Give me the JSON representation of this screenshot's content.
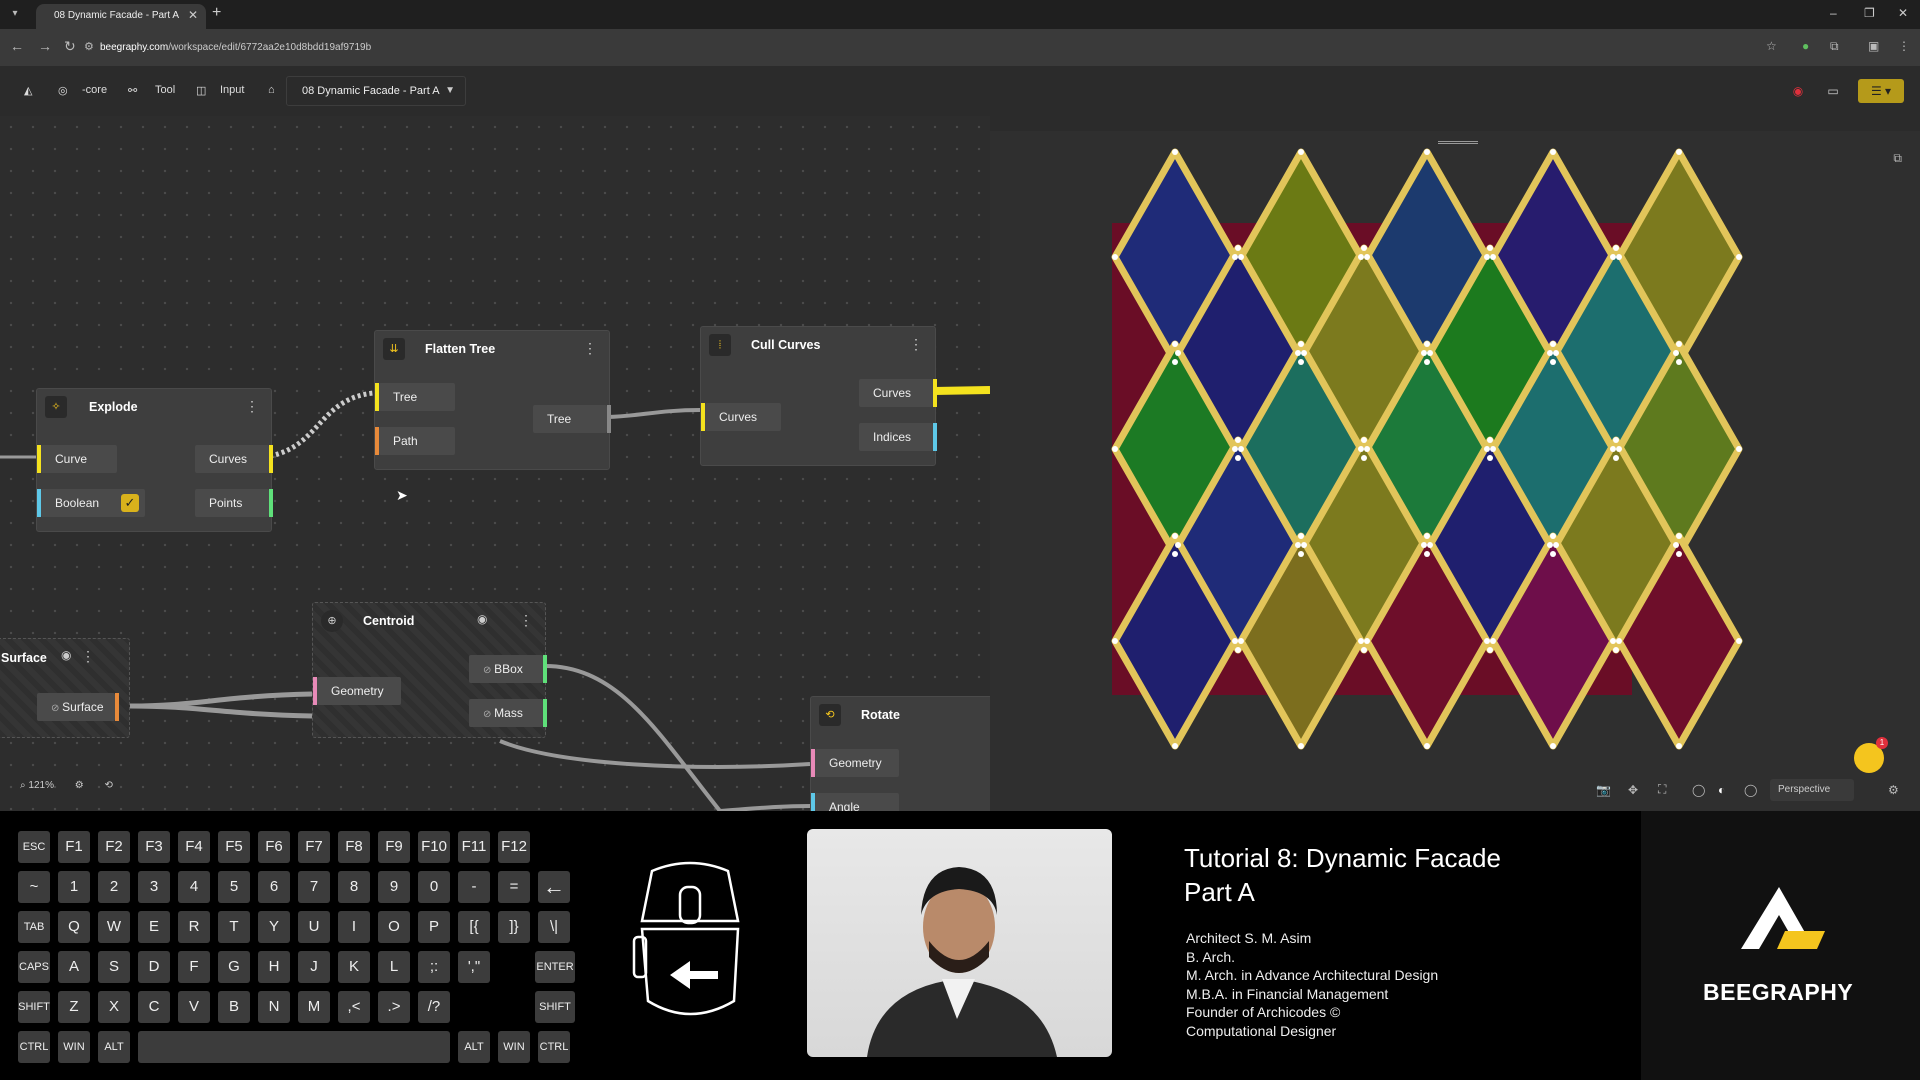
{
  "browser": {
    "tab_title": "08 Dynamic Facade - Part A",
    "url_host": "beegraphy.com",
    "url_path": "/workspace/edit/6772aa2e10d8bdd19af9719b"
  },
  "toolbar": {
    "core_label": "-core",
    "tool_label": "Tool",
    "input_label": "Input",
    "project_name": "08 Dynamic Facade - Part A"
  },
  "nodes": {
    "explode": {
      "title": "Explode",
      "inputs": [
        "Curve",
        "Boolean"
      ],
      "outputs": [
        "Curves",
        "Points"
      ]
    },
    "flatten": {
      "title": "Flatten Tree",
      "inputs": [
        "Tree",
        "Path"
      ],
      "outputs": [
        "Tree"
      ]
    },
    "cull": {
      "title": "Cull Curves",
      "inputs": [
        "Curves"
      ],
      "outputs": [
        "Curves",
        "Indices"
      ]
    },
    "surface": {
      "title": "Surface",
      "outputs": [
        "Surface"
      ]
    },
    "centroid": {
      "title": "Centroid",
      "inputs": [
        "Geometry"
      ],
      "outputs": [
        "BBox",
        "Mass"
      ]
    },
    "rotate": {
      "title": "Rotate",
      "inputs": [
        "Geometry",
        "Angle"
      ]
    }
  },
  "graph": {
    "zoom": "121%"
  },
  "viewport": {
    "projection": "Perspective",
    "notification_count": "1"
  },
  "keyboard": {
    "row1": [
      "ESC",
      "F1",
      "F2",
      "F3",
      "F4",
      "F5",
      "F6",
      "F7",
      "F8",
      "F9",
      "F10",
      "F11",
      "F12"
    ],
    "row2": [
      "~",
      "1",
      "2",
      "3",
      "4",
      "5",
      "6",
      "7",
      "8",
      "9",
      "0",
      "-",
      "=",
      "←"
    ],
    "row3": [
      "TAB",
      "Q",
      "W",
      "E",
      "R",
      "T",
      "Y",
      "U",
      "I",
      "O",
      "P",
      "[{",
      "]}",
      "\\|"
    ],
    "row4": [
      "CAPS",
      "A",
      "S",
      "D",
      "F",
      "G",
      "H",
      "J",
      "K",
      "L",
      ";:",
      "',\"",
      "ENTER"
    ],
    "row5": [
      "SHIFT",
      "Z",
      "X",
      "C",
      "V",
      "B",
      "N",
      "M",
      ",<",
      ".>",
      "/?",
      "SHIFT"
    ],
    "row6": [
      "CTRL",
      "WIN",
      "ALT",
      "",
      "ALT",
      "WIN",
      "CTRL"
    ]
  },
  "tutorial": {
    "title_line1": "Tutorial 8: Dynamic Facade",
    "title_line2": "Part A",
    "credits": [
      "Architect S. M. Asim",
      "B. Arch.",
      "M. Arch. in Advance Architectural Design",
      "M.B.A. in Financial Management",
      "Founder of Archicodes ©",
      "Computational Designer"
    ]
  },
  "brand": {
    "name": "BEEGRAPHY",
    "yellow": "#f4c51e"
  },
  "colors": {
    "pin_yellow": "#f4e21e",
    "pin_cyan": "#5ec8e8",
    "pin_green": "#5fe07a",
    "pin_orange": "#e88a3a",
    "pin_pink": "#e88ab8"
  }
}
